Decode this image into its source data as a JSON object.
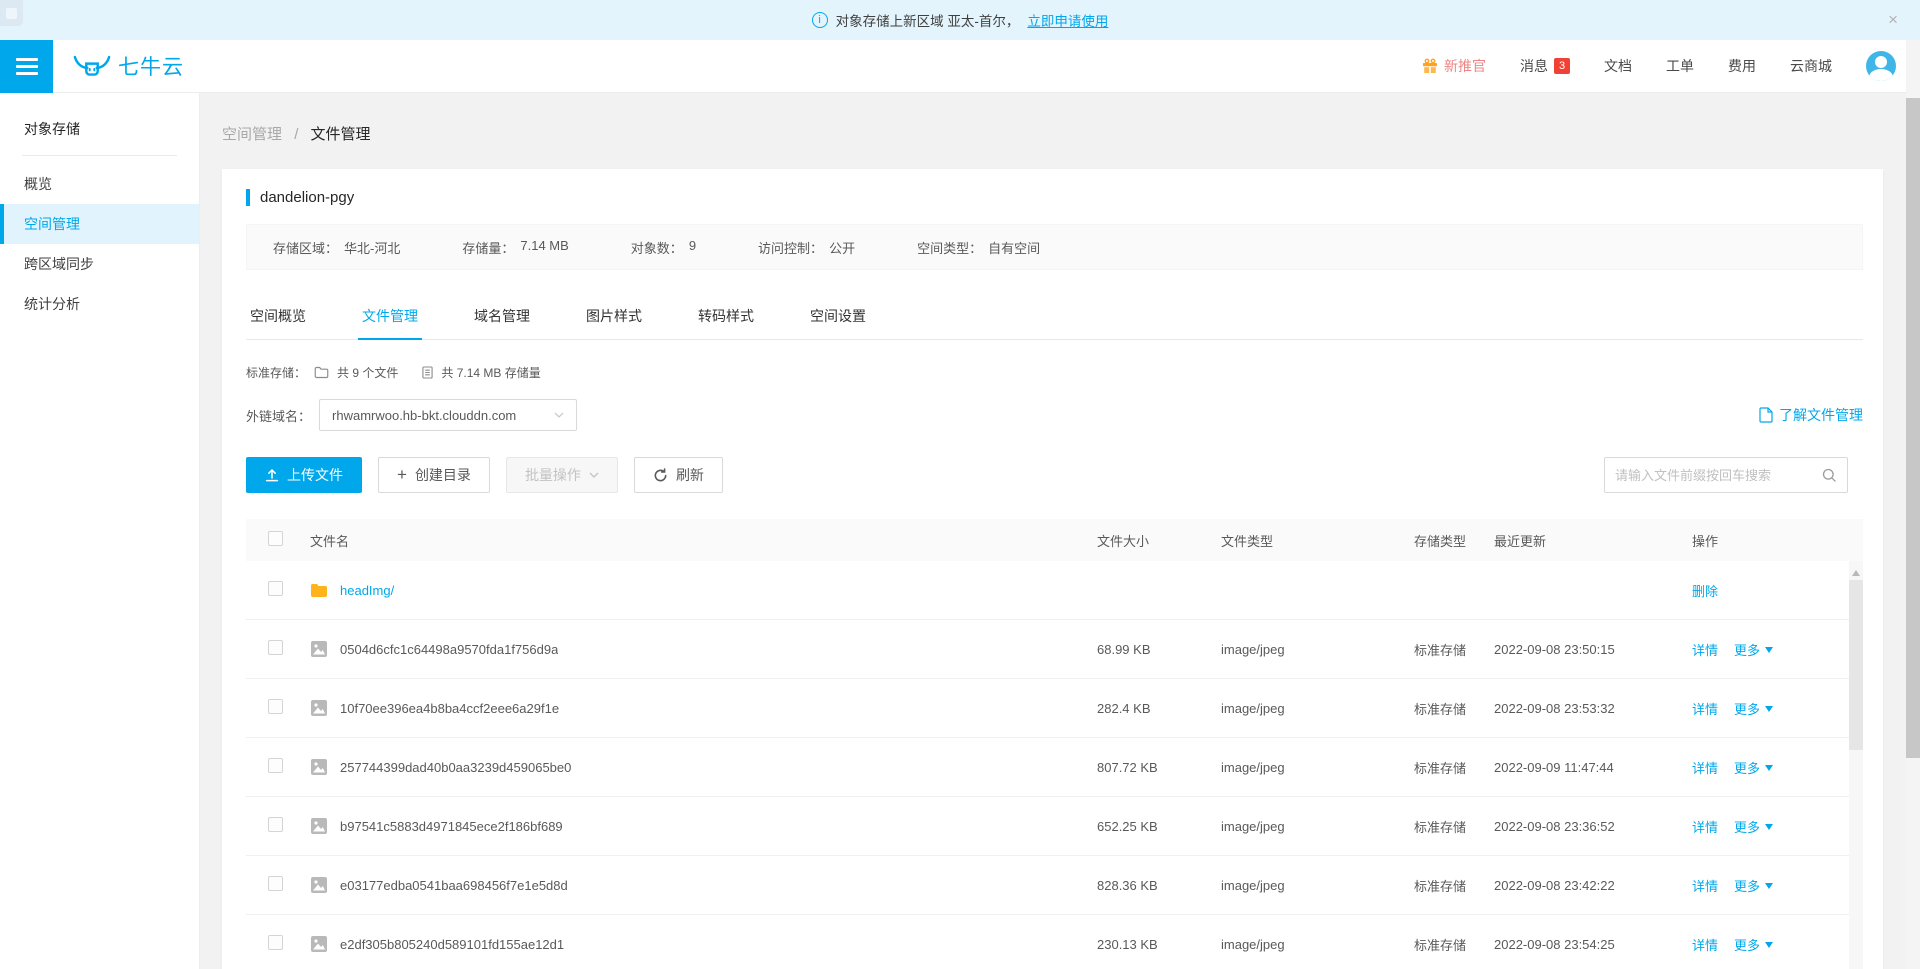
{
  "colors": {
    "accent": "#00a8eb",
    "badge_red": "#f04134",
    "gift_orange": "#ffa21d",
    "folder_yellow": "#ffb41d"
  },
  "notification": {
    "text": "对象存储上新区域 亚太-首尔，",
    "link": "立即申请使用",
    "close": "×",
    "info_glyph": "i"
  },
  "header": {
    "logo_text": "七牛云",
    "nav": {
      "promo": "新推官",
      "messages": "消息",
      "messages_badge": "3",
      "docs": "文档",
      "tickets": "工单",
      "billing": "费用",
      "market": "云商城"
    }
  },
  "sidebar": {
    "title": "对象存储",
    "items": [
      {
        "label": "概览"
      },
      {
        "label": "空间管理"
      },
      {
        "label": "跨区域同步"
      },
      {
        "label": "统计分析"
      }
    ]
  },
  "breadcrumb": {
    "parent": "空间管理",
    "separator": "/",
    "current": "文件管理"
  },
  "bucket": {
    "name": "dandelion-pgy",
    "info": [
      {
        "label": "存储区域：",
        "value": "华北-河北"
      },
      {
        "label": "存储量：",
        "value": "7.14 MB"
      },
      {
        "label": "对象数：",
        "value": "9"
      },
      {
        "label": "访问控制：",
        "value": "公开"
      },
      {
        "label": "空间类型：",
        "value": "自有空间"
      }
    ],
    "tabs": [
      {
        "label": "空间概览"
      },
      {
        "label": "文件管理"
      },
      {
        "label": "域名管理"
      },
      {
        "label": "图片样式"
      },
      {
        "label": "转码样式"
      },
      {
        "label": "空间设置"
      }
    ]
  },
  "summary": {
    "prefix": "标准存储：",
    "files": "共 9 个文件",
    "size": "共 7.14 MB 存储量"
  },
  "domain": {
    "label": "外链域名：",
    "value": "rhwamrwoo.hb-bkt.clouddn.com"
  },
  "learn_link": "了解文件管理",
  "toolbar": {
    "upload": "上传文件",
    "create_dir": "创建目录",
    "batch": "批量操作",
    "refresh": "刷新",
    "search_placeholder": "请输入文件前缀按回车搜索"
  },
  "table": {
    "headers": [
      "文件名",
      "文件大小",
      "文件类型",
      "存储类型",
      "最近更新",
      "操作"
    ],
    "action_labels": {
      "delete": "删除",
      "detail": "详情",
      "more": "更多"
    },
    "rows": [
      {
        "name": "headImg/",
        "size": "",
        "mime": "",
        "storage": "",
        "updated": ""
      },
      {
        "name": "0504d6cfc1c64498a9570fda1f756d9a",
        "size": "68.99 KB",
        "mime": "image/jpeg",
        "storage": "标准存储",
        "updated": "2022-09-08 23:50:15"
      },
      {
        "name": "10f70ee396ea4b8ba4ccf2eee6a29f1e",
        "size": "282.4 KB",
        "mime": "image/jpeg",
        "storage": "标准存储",
        "updated": "2022-09-08 23:53:32"
      },
      {
        "name": "257744399dad40b0aa3239d459065be0",
        "size": "807.72 KB",
        "mime": "image/jpeg",
        "storage": "标准存储",
        "updated": "2022-09-09 11:47:44"
      },
      {
        "name": "b97541c5883d4971845ece2f186bf689",
        "size": "652.25 KB",
        "mime": "image/jpeg",
        "storage": "标准存储",
        "updated": "2022-09-08 23:36:52"
      },
      {
        "name": "e03177edba0541baa698456f7e1e5d8d",
        "size": "828.36 KB",
        "mime": "image/jpeg",
        "storage": "标准存储",
        "updated": "2022-09-08 23:42:22"
      },
      {
        "name": "e2df305b805240d589101fd155ae12d1",
        "size": "230.13 KB",
        "mime": "image/jpeg",
        "storage": "标准存储",
        "updated": "2022-09-08 23:54:25"
      }
    ]
  }
}
